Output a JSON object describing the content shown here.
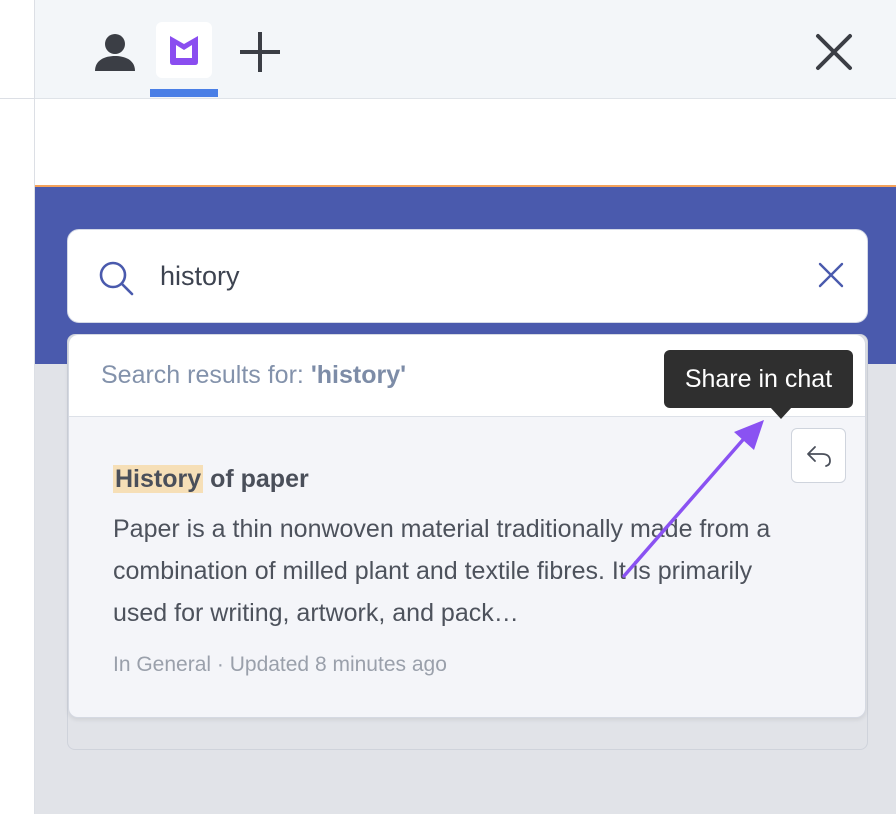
{
  "topbar": {
    "tabs": [
      {
        "icon": "person-icon"
      },
      {
        "icon": "app-logo-icon",
        "active": true
      },
      {
        "icon": "plus-icon"
      }
    ],
    "close_icon": "close-icon"
  },
  "search": {
    "value": "history",
    "icon": "search-icon",
    "clear_icon": "clear-icon"
  },
  "results": {
    "label_prefix": "Search results for: ",
    "label_query": "'history'",
    "items": [
      {
        "title_highlight": "History",
        "title_rest": " of paper",
        "snippet": "Paper is a thin nonwoven material traditionally made from a combination of milled plant and textile fibres. It is primarily used for writing, artwork, and pack…",
        "meta": "In General · Updated 8 minutes ago",
        "share_icon": "share-reply-icon"
      }
    ]
  },
  "tooltip": {
    "text": "Share in chat"
  },
  "colors": {
    "header_band": "#4a5aad",
    "accent_tab": "#4a7fe6",
    "logo": "#8a4df0",
    "highlight": "#f6dfb7",
    "annotation_arrow": "#8a52f2"
  }
}
